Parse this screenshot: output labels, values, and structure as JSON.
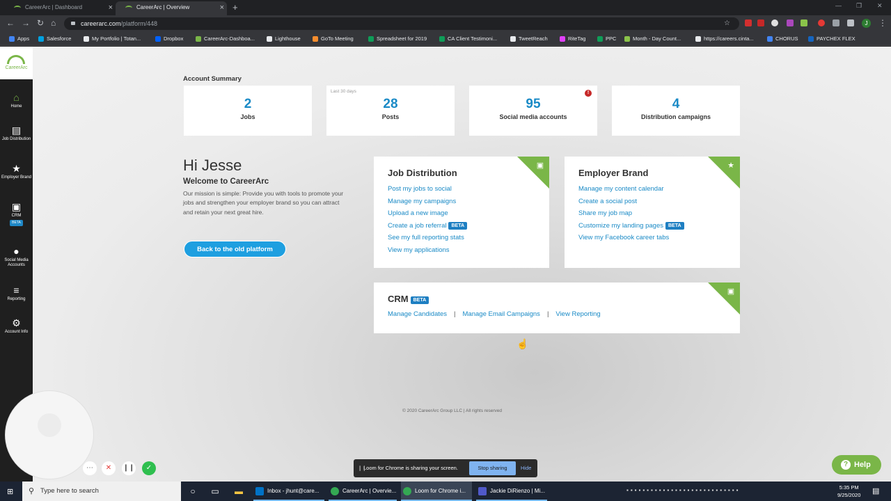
{
  "browser": {
    "tabs": [
      {
        "title": "CareerArc | Dashboard",
        "active": false
      },
      {
        "title": "CareerArc | Overview",
        "active": true
      }
    ],
    "url_host": "careerarc.com",
    "url_path": "/platform/448",
    "profile_initial": "J",
    "bookmarks": [
      {
        "label": "Apps",
        "color": "#4285f4"
      },
      {
        "label": "Salesforce",
        "color": "#00a1e0"
      },
      {
        "label": "My Portfolio | Totan...",
        "color": "#e8eaed"
      },
      {
        "label": "Dropbox",
        "color": "#0061ff"
      },
      {
        "label": "CareerArc-Dashboa...",
        "color": "#7ab648"
      },
      {
        "label": "Lighthouse",
        "color": "#e8eaed"
      },
      {
        "label": "GoTo Meeting",
        "color": "#f68d2e"
      },
      {
        "label": "Spreadsheet for 2019",
        "color": "#0f9d58"
      },
      {
        "label": "CA Client Testimoni...",
        "color": "#0f9d58"
      },
      {
        "label": "TweetReach",
        "color": "#e8eaed"
      },
      {
        "label": "RiteTag",
        "color": "#e040fb"
      },
      {
        "label": "PPC",
        "color": "#0f9d58"
      },
      {
        "label": "Month - Day Count...",
        "color": "#8bc34a"
      },
      {
        "label": "https://careers.cinta...",
        "color": "#e8eaed"
      },
      {
        "label": "CHORUS",
        "color": "#4285f4"
      },
      {
        "label": "PAYCHEX FLEX",
        "color": "#1565c0"
      }
    ]
  },
  "sidebar": {
    "logo_text": "CareerArc",
    "items": [
      {
        "label": "Home",
        "icon": "home-icon",
        "glyph": "⌂"
      },
      {
        "label": "Job Distribution",
        "icon": "briefcase-icon",
        "glyph": "▤"
      },
      {
        "label": "Employer Brand",
        "icon": "star-icon",
        "glyph": "★"
      },
      {
        "label": "CRM",
        "icon": "contact-icon",
        "glyph": "▣",
        "badge": "BETA"
      },
      {
        "label": "Social Media Accounts",
        "icon": "social-icon",
        "glyph": "●"
      },
      {
        "label": "Reporting",
        "icon": "reporting-icon",
        "glyph": "≡"
      },
      {
        "label": "Account Info",
        "icon": "gear-icon",
        "glyph": "⚙"
      }
    ]
  },
  "summary": {
    "title": "Account Summary",
    "stats": [
      {
        "value": "2",
        "label": "Jobs"
      },
      {
        "value": "28",
        "label": "Posts",
        "sub": "Last 30 days"
      },
      {
        "value": "95",
        "label": "Social media accounts",
        "alert": "!"
      },
      {
        "value": "4",
        "label": "Distribution campaigns"
      }
    ]
  },
  "greeting": {
    "hi": "Hi Jesse",
    "welcome": "Welcome to CareerArc",
    "mission": "Our mission is simple: Provide you with tools to promote your jobs and strengthen your employer brand so you can attract and retain your next great hire.",
    "old_platform_button": "Back to the old platform"
  },
  "job_distribution": {
    "title": "Job Distribution",
    "links": [
      {
        "label": "Post my jobs to social"
      },
      {
        "label": "Manage my campaigns"
      },
      {
        "label": "Upload a new image"
      },
      {
        "label": "Create a job referral",
        "badge": "BETA"
      },
      {
        "label": "See my full reporting stats"
      },
      {
        "label": "View my applications"
      }
    ]
  },
  "employer_brand": {
    "title": "Employer Brand",
    "links": [
      {
        "label": "Manage my content calendar"
      },
      {
        "label": "Create a social post"
      },
      {
        "label": "Share my job map"
      },
      {
        "label": "Customize my landing pages",
        "badge": "BETA"
      },
      {
        "label": "View my Facebook career tabs"
      }
    ]
  },
  "crm": {
    "title": "CRM",
    "badge": "BETA",
    "links": [
      "Manage Candidates",
      "Manage Email Campaigns",
      "View Reporting"
    ],
    "separator": "|"
  },
  "footer": "© 2020 CareerArc Group LLC  |  All rights reserved",
  "loom": {
    "message": "Loom for Chrome is sharing your screen.",
    "stop": "Stop sharing",
    "hide": "Hide"
  },
  "help_button": "Help",
  "taskbar": {
    "search_placeholder": "Type here to search",
    "apps": [
      {
        "label": "Inbox - jhunt@care...",
        "color": "#0072c6"
      },
      {
        "label": "CareerArc | Overvie...",
        "color": "#34a853"
      },
      {
        "label": "Loom for Chrome i...",
        "color": "#34a853"
      },
      {
        "label": "Jackie DiRienzo | Mi...",
        "color": "#5059c9"
      }
    ],
    "time": "5:35 PM",
    "date": "9/25/2020"
  }
}
